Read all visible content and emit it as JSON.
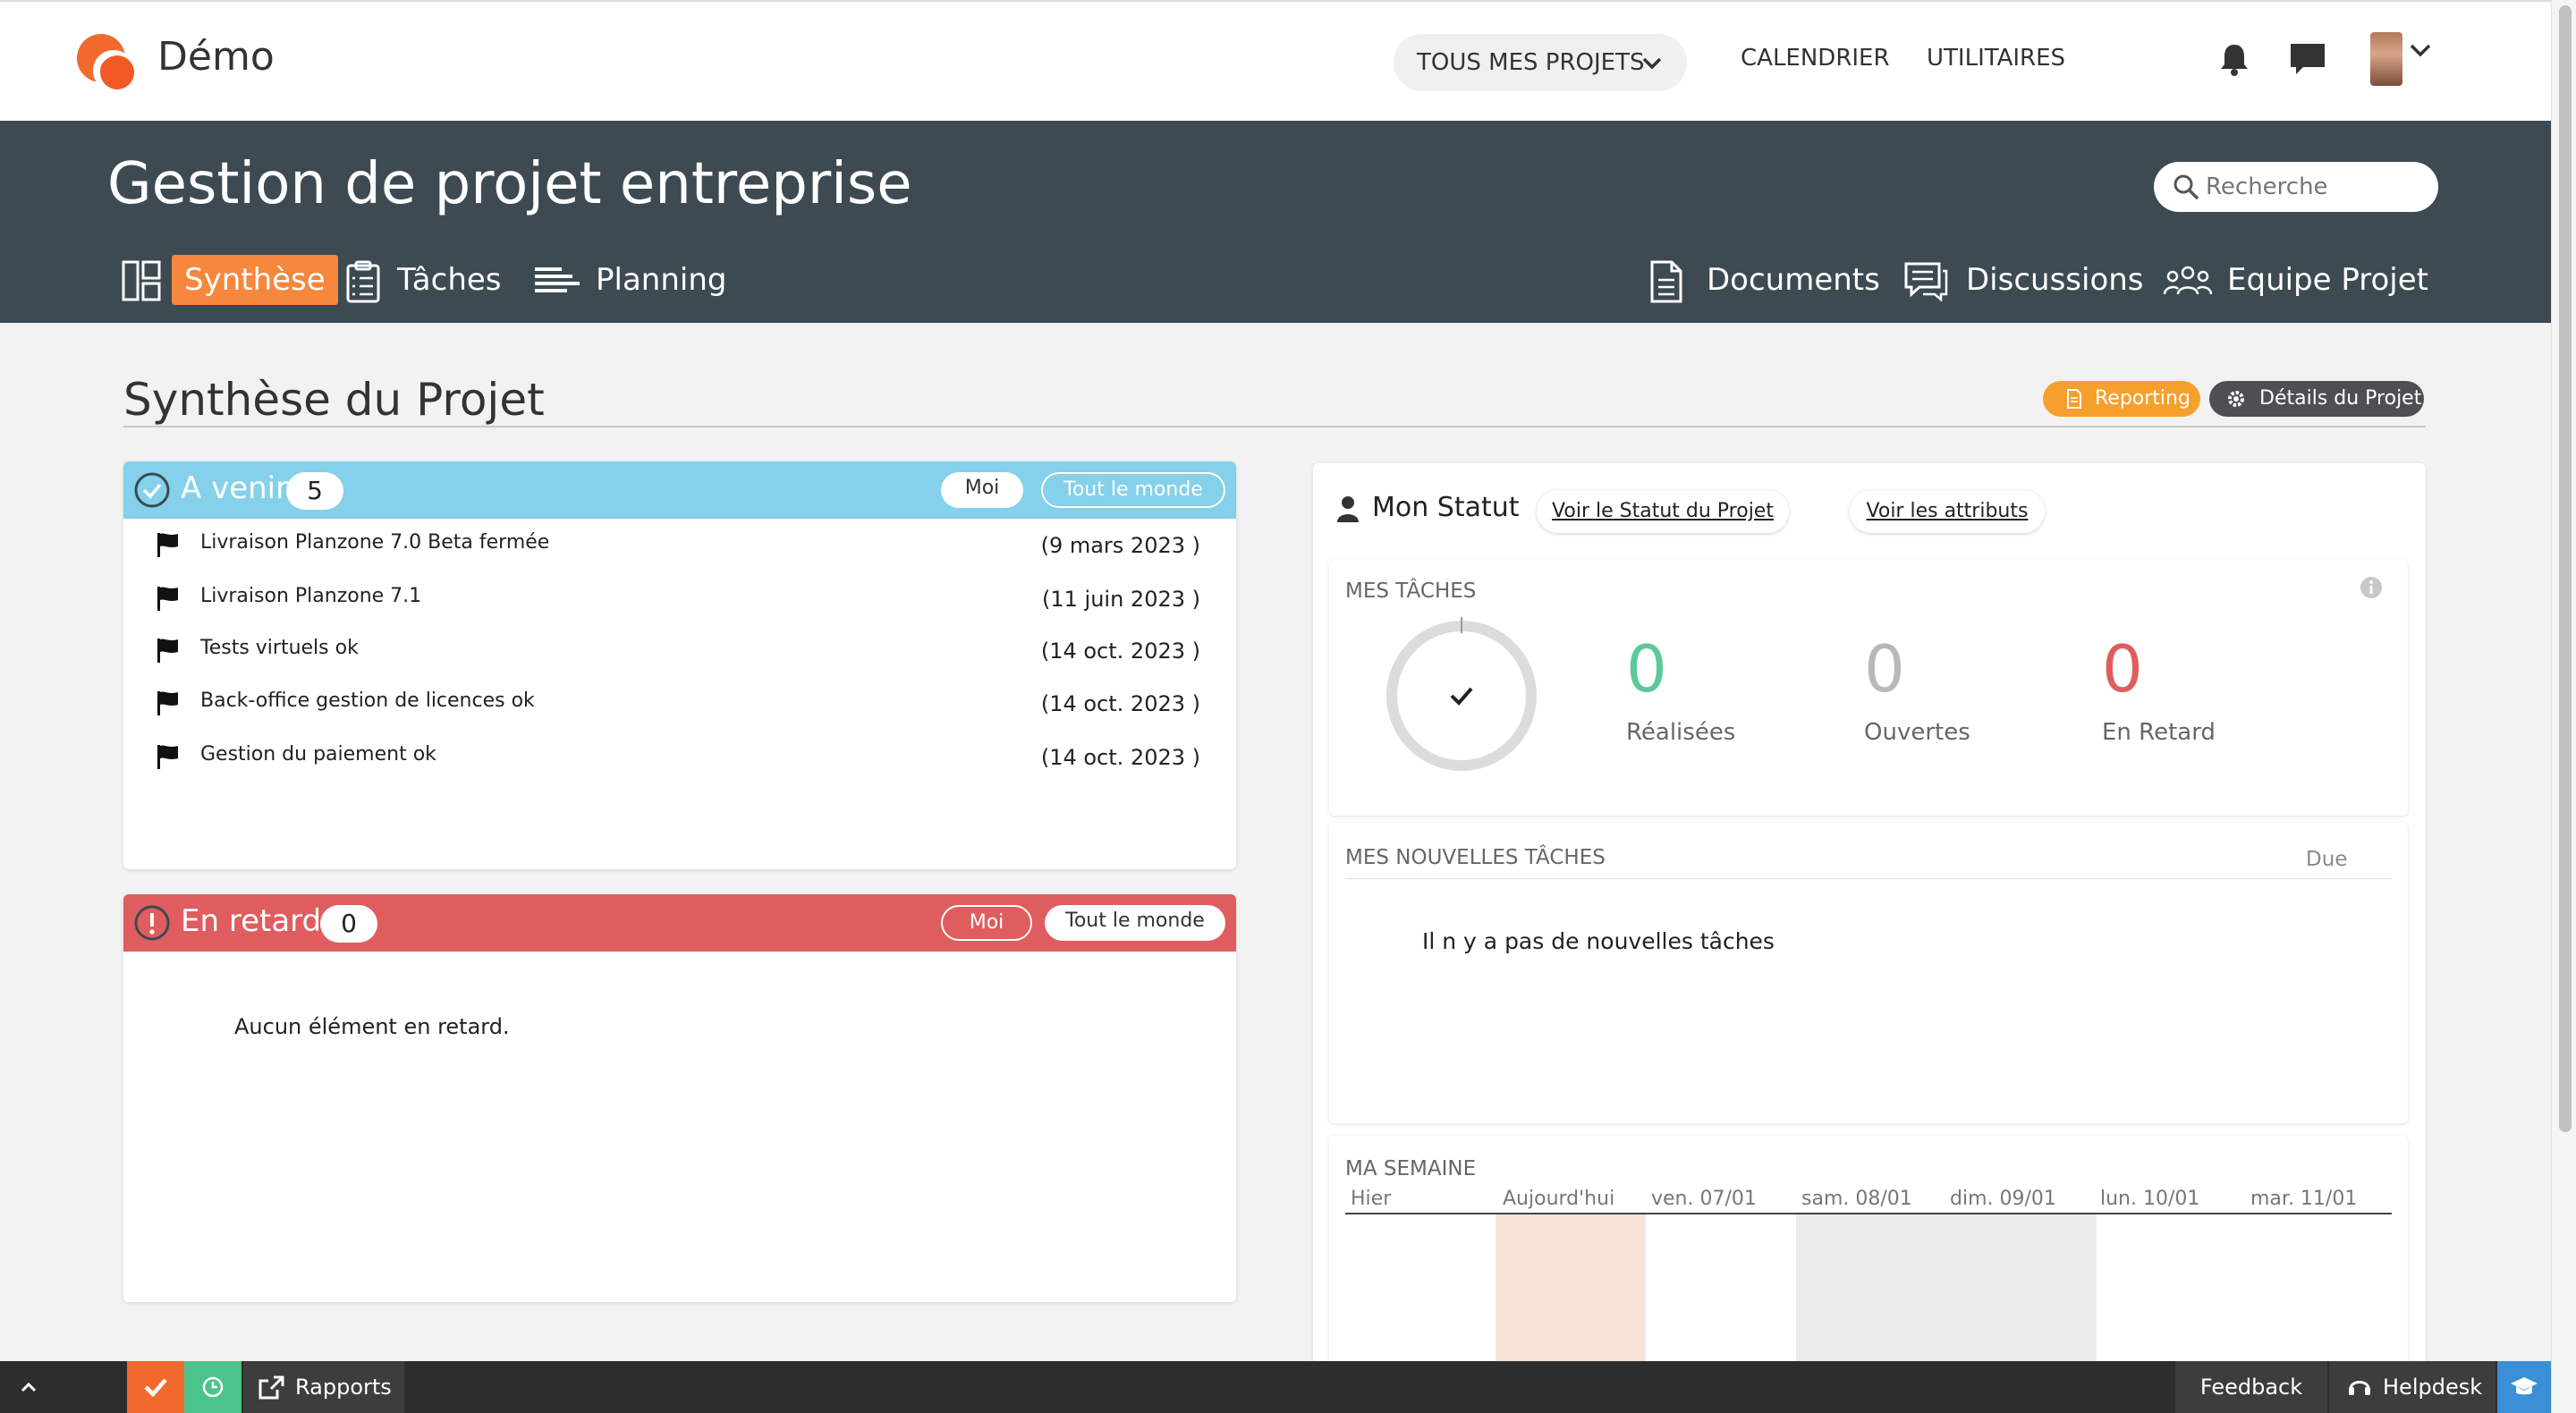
{
  "app": {
    "brand": "Démo"
  },
  "topnav": {
    "projects": "TOUS MES PROJETS",
    "calendar": "CALENDRIER",
    "utilities": "UTILITAIRES"
  },
  "banner": {
    "title": "Gestion de projet entreprise",
    "search_placeholder": "Recherche",
    "tabs": {
      "synthese": "Synthèse",
      "taches": "Tâches",
      "planning": "Planning",
      "documents": "Documents",
      "discussions": "Discussions",
      "equipe": "Equipe Projet"
    }
  },
  "page": {
    "title": "Synthèse du Projet",
    "reporting": "Reporting",
    "details": "Détails du Projet"
  },
  "upcoming": {
    "title": "A venir",
    "count": "5",
    "me": "Moi",
    "everyone": "Tout le monde",
    "items": [
      {
        "label": "Livraison Planzone 7.0 Beta fermée",
        "date": "(9 mars 2023 )"
      },
      {
        "label": "Livraison Planzone 7.1",
        "date": "(11 juin 2023 )"
      },
      {
        "label": "Tests virtuels ok",
        "date": "(14 oct. 2023 )"
      },
      {
        "label": "Back-office gestion de licences ok",
        "date": "(14 oct. 2023 )"
      },
      {
        "label": "Gestion du paiement ok",
        "date": "(14 oct. 2023 )"
      }
    ]
  },
  "late": {
    "title": "En retard",
    "count": "0",
    "me": "Moi",
    "everyone": "Tout le monde",
    "empty": "Aucun élément en retard."
  },
  "status": {
    "title": "Mon Statut",
    "view_status": "Voir le Statut du Projet",
    "view_attributes": "Voir les attributs",
    "my_tasks": "MES TÂCHES",
    "done_count": "0",
    "done_label": "Réalisées",
    "open_count": "0",
    "open_label": "Ouvertes",
    "late_count": "0",
    "late_label": "En Retard",
    "new_tasks": "MES NOUVELLES TÂCHES",
    "due": "Due",
    "no_new": "Il n y a pas de nouvelles tâches",
    "week": "MA SEMAINE",
    "days": [
      "Hier",
      "Aujourd'hui",
      "ven. 07/01",
      "sam. 08/01",
      "dim. 09/01",
      "lun. 10/01",
      "mar. 11/01"
    ]
  },
  "bottombar": {
    "reports": "Rapports",
    "feedback": "Feedback",
    "helpdesk": "Helpdesk"
  },
  "colors": {
    "accent": "#f6873c",
    "banner": "#3d4a52",
    "upcoming": "#85d0ea",
    "late": "#e05d5f",
    "done": "#5cc99a",
    "late_num": "#e05d5f"
  }
}
